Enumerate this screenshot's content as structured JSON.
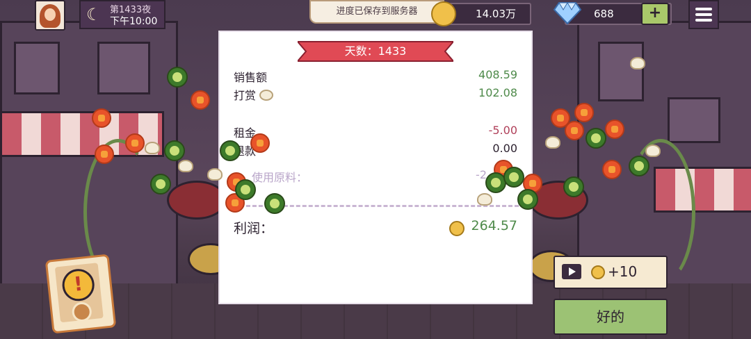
{
  "header": {
    "night_label": "第1433夜",
    "time_label": "下午10:00",
    "toast": "进度已保存到服务器",
    "coins": "14.03万",
    "gems": "688",
    "plus_label": "+"
  },
  "receipt": {
    "banner": "天数：1433",
    "rows": [
      {
        "label": "销售额",
        "value": "408.59",
        "tone": "green"
      },
      {
        "label": "打赏",
        "value": "102.08",
        "tone": "green"
      },
      {
        "label": "租金",
        "value": "-5.00",
        "tone": "red"
      },
      {
        "label": "退款",
        "value": "0.00",
        "tone": "dark"
      },
      {
        "label": "使用原料：",
        "value": "-2",
        "tone": "faded"
      }
    ],
    "profit_label": "利润：",
    "profit_value": "264.57"
  },
  "buttons": {
    "ad_reward": "+10",
    "ok": "好的"
  },
  "icons": [
    "moon-icon",
    "coin-icon",
    "diamond-icon",
    "menu-icon",
    "play-icon",
    "alert-icon",
    "nut-icon"
  ],
  "colors": {
    "accent_green": "#4e8a4a",
    "negative_red": "#b0405a",
    "banner_red": "#e04a55"
  }
}
